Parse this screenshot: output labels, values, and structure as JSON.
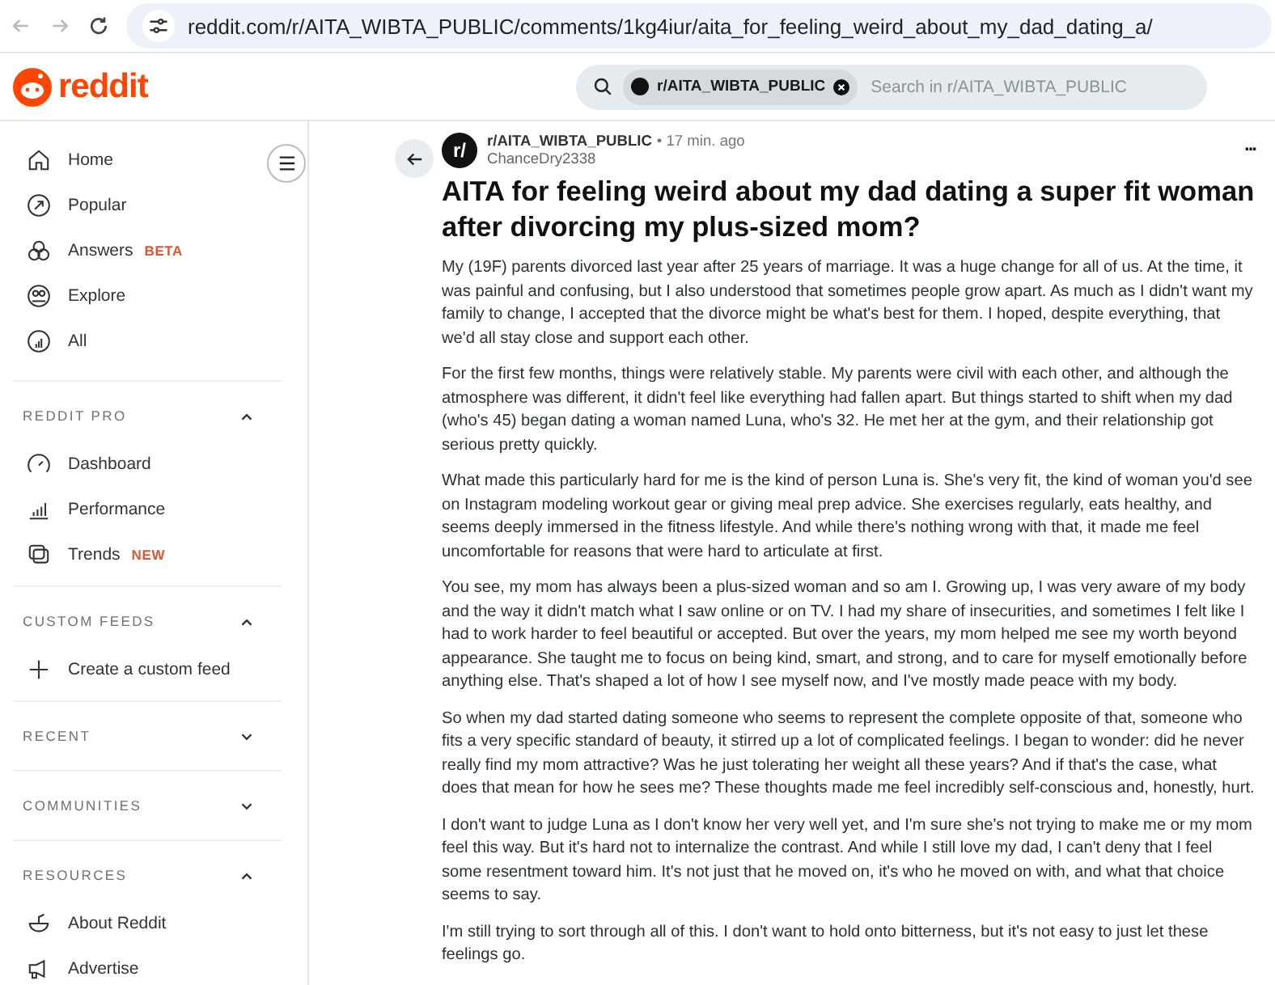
{
  "browser": {
    "url": "reddit.com/r/AITA_WIBTA_PUBLIC/comments/1kg4iur/aita_for_feeling_weird_about_my_dad_dating_a/"
  },
  "header": {
    "logo": "reddit",
    "search": {
      "chip": "r/AITA_WIBTA_PUBLIC",
      "placeholder": "Search in r/AITA_WIBTA_PUBLIC"
    }
  },
  "sidebar": {
    "items": [
      {
        "label": "Home"
      },
      {
        "label": "Popular"
      },
      {
        "label": "Answers",
        "badge": "BETA"
      },
      {
        "label": "Explore"
      },
      {
        "label": "All"
      }
    ],
    "sections": [
      {
        "title": "REDDIT PRO",
        "expanded": true,
        "items": [
          {
            "label": "Dashboard"
          },
          {
            "label": "Performance"
          },
          {
            "label": "Trends",
            "badge": "NEW"
          }
        ]
      },
      {
        "title": "CUSTOM FEEDS",
        "expanded": true,
        "items": [
          {
            "label": "Create a custom feed"
          }
        ]
      },
      {
        "title": "RECENT",
        "expanded": false
      },
      {
        "title": "COMMUNITIES",
        "expanded": false
      },
      {
        "title": "RESOURCES",
        "expanded": true,
        "items": [
          {
            "label": "About Reddit"
          },
          {
            "label": "Advertise"
          }
        ]
      }
    ]
  },
  "post": {
    "avatar": "r/",
    "subreddit": "r/AITA_WIBTA_PUBLIC",
    "time": "• 17 min. ago",
    "author": "ChanceDry2338",
    "more": "...",
    "title": "AITA for feeling weird about my dad dating a super fit woman after divorcing my plus-sized mom?",
    "paragraphs": [
      "My (19F) parents divorced last year after 25 years of marriage. It was a huge change for all of us. At the time, it was painful and confusing, but I also understood that sometimes people grow apart. As much as I didn't want my family to change, I accepted that the divorce might be what's best for them. I hoped, despite everything, that we'd all stay close and support each other.",
      "For the first few months, things were relatively stable. My parents were civil with each other, and although the atmosphere was different, it didn't feel like everything had fallen apart. But things started to shift when my dad (who's 45) began dating a woman named Luna, who's 32. He met her at the gym, and their relationship got serious pretty quickly.",
      "What made this particularly hard for me is the kind of person Luna is. She's very fit, the kind of woman you'd see on Instagram modeling workout gear or giving meal prep advice. She exercises regularly, eats healthy, and seems deeply immersed in the fitness lifestyle. And while there's nothing wrong with that, it made me feel uncomfortable for reasons that were hard to articulate at first.",
      "You see, my mom has always been a plus-sized woman and so am I. Growing up, I was very aware of my body and the way it didn't match what I saw online or on TV. I had my share of insecurities, and sometimes I felt like I had to work harder to feel beautiful or accepted. But over the years, my mom helped me see my worth beyond appearance. She taught me to focus on being kind, smart, and strong, and to care for myself emotionally before anything else. That's shaped a lot of how I see myself now, and I've mostly made peace with my body.",
      "So when my dad started dating someone who seems to represent the complete opposite of that, someone who fits a very specific standard of beauty, it stirred up a lot of complicated feelings. I began to wonder: did he never really find my mom attractive? Was he just tolerating her weight all these years? And if that's the case, what does that mean for how he sees me? These thoughts made me feel incredibly self-conscious and, honestly, hurt.",
      "I don't want to judge Luna as I don't know her very well yet, and I'm sure she's not trying to make me or my mom feel this way. But it's hard not to internalize the contrast. And while I still love my dad, I can't deny that I feel some resentment toward him. It's not just that he moved on, it's who he moved on with, and what that choice seems to say.",
      "I'm still trying to sort through all of this. I don't want to hold onto bitterness, but it's not easy to just let these feelings go."
    ]
  }
}
